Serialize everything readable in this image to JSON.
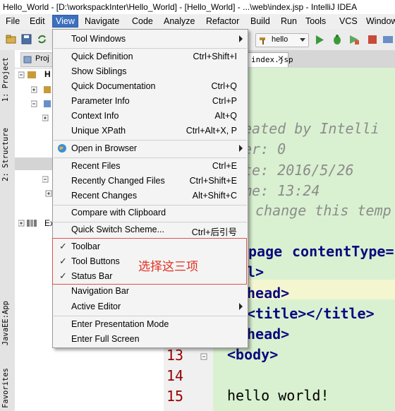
{
  "window": {
    "title": "Hello_World - [D:\\workspackInter\\Hello_World] - [Hello_World] - ...\\web\\index.jsp - IntelliJ IDEA"
  },
  "menubar": {
    "items": [
      "File",
      "Edit",
      "View",
      "Navigate",
      "Code",
      "Analyze",
      "Refactor",
      "Build",
      "Run",
      "Tools",
      "VCS",
      "Window"
    ],
    "active": "View"
  },
  "toolbar": {
    "run_config": "hello"
  },
  "side_tabs": {
    "project": "1: Project",
    "structure": "2: Structure",
    "javaee": "JavaEE:App",
    "favorites": "Favorites"
  },
  "project_panel": {
    "tab_label": "Proj",
    "tree": [
      "H",
      "Ex"
    ]
  },
  "editor": {
    "tab": "index.jsp",
    "line_numbers": [
      "13",
      "14",
      "15"
    ],
    "comment_lines": [
      "eated by Intelli",
      "er: 0",
      "te: 2016/5/26",
      "me: 13:24",
      "change this temp"
    ],
    "code_lines": {
      "page": "page",
      "content_type": "contentType=",
      "l": "l>",
      "head_open": "head>",
      "title": "<title></title>",
      "head_close": "head>",
      "body": "<body>",
      "hello": "hello world!"
    }
  },
  "view_menu": {
    "items": [
      {
        "label": "Tool Windows",
        "shortcut": "",
        "submenu": true,
        "checked": false
      },
      {
        "label": "Quick Definition",
        "shortcut": "Ctrl+Shift+I",
        "submenu": false,
        "checked": false
      },
      {
        "label": "Show Siblings",
        "shortcut": "",
        "submenu": false,
        "checked": false
      },
      {
        "label": "Quick Documentation",
        "shortcut": "Ctrl+Q",
        "submenu": false,
        "checked": false
      },
      {
        "label": "Parameter Info",
        "shortcut": "Ctrl+P",
        "submenu": false,
        "checked": false
      },
      {
        "label": "Context Info",
        "shortcut": "Alt+Q",
        "submenu": false,
        "checked": false
      },
      {
        "label": "Unique XPath",
        "shortcut": "Ctrl+Alt+X, P",
        "submenu": false,
        "checked": false
      },
      {
        "label": "Open in Browser",
        "shortcut": "",
        "submenu": true,
        "checked": false
      },
      {
        "label": "Recent Files",
        "shortcut": "Ctrl+E",
        "submenu": false,
        "checked": false
      },
      {
        "label": "Recently Changed Files",
        "shortcut": "Ctrl+Shift+E",
        "submenu": false,
        "checked": false
      },
      {
        "label": "Recent Changes",
        "shortcut": "Alt+Shift+C",
        "submenu": false,
        "checked": false
      },
      {
        "label": "Compare with Clipboard",
        "shortcut": "",
        "submenu": false,
        "checked": false
      },
      {
        "label": "Quick Switch Scheme...",
        "shortcut": "Ctrl+后引号",
        "submenu": false,
        "checked": false
      },
      {
        "label": "Toolbar",
        "shortcut": "",
        "submenu": false,
        "checked": true
      },
      {
        "label": "Tool Buttons",
        "shortcut": "",
        "submenu": false,
        "checked": true
      },
      {
        "label": "Status Bar",
        "shortcut": "",
        "submenu": false,
        "checked": true
      },
      {
        "label": "Navigation Bar",
        "shortcut": "",
        "submenu": false,
        "checked": false
      },
      {
        "label": "Active Editor",
        "shortcut": "",
        "submenu": true,
        "checked": false
      },
      {
        "label": "Enter Presentation Mode",
        "shortcut": "",
        "submenu": false,
        "checked": false
      },
      {
        "label": "Enter Full Screen",
        "shortcut": "",
        "submenu": false,
        "checked": false
      }
    ]
  },
  "annotation": {
    "text": "选择这三项",
    "color": "#e03020"
  },
  "colors": {
    "menu_highlight": "#3c6fbd",
    "editor_bg": "#d9f1d0",
    "run_green": "#3a9a3a"
  }
}
